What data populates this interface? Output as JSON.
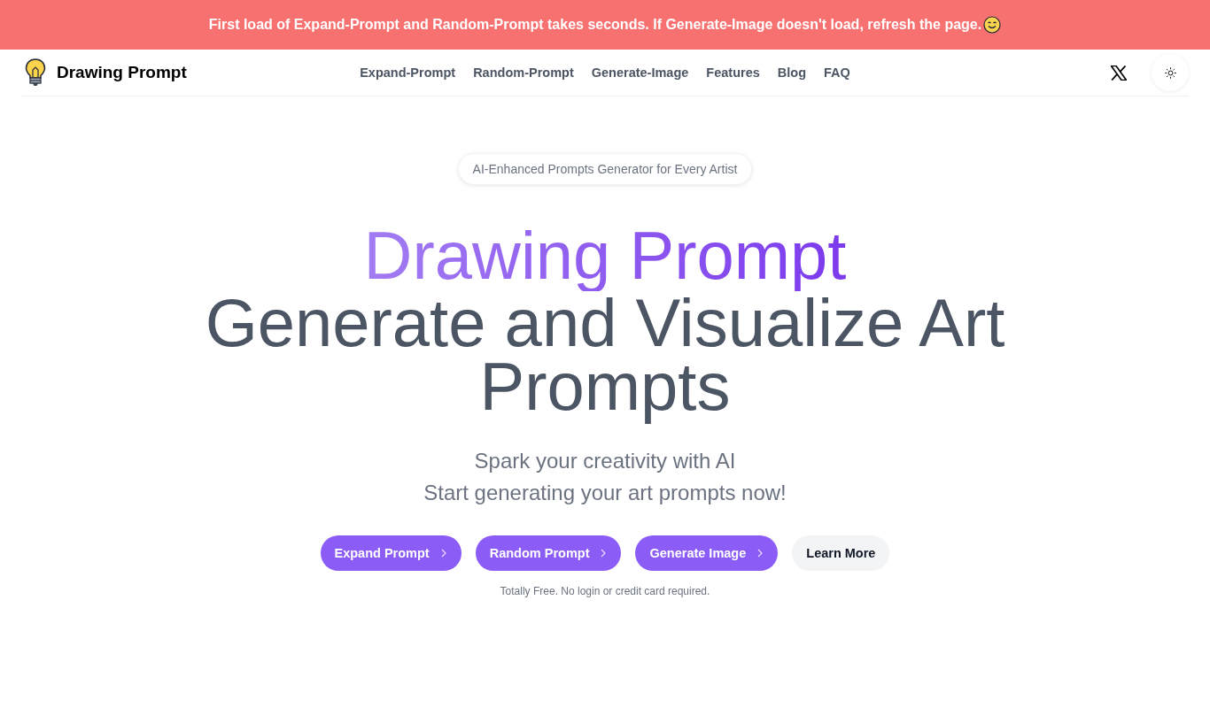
{
  "banner": {
    "text": "First load of Expand-Prompt and Random-Prompt takes seconds. If Generate-Image doesn't load, refresh the page."
  },
  "header": {
    "brand": "Drawing Prompt",
    "nav": [
      "Expand-Prompt",
      "Random-Prompt",
      "Generate-Image",
      "Features",
      "Blog",
      "FAQ"
    ]
  },
  "hero": {
    "badge": "AI-Enhanced Prompts Generator for Every Artist",
    "title": "Drawing Prompt",
    "headline": "Generate and Visualize Art Prompts",
    "tagline": [
      "Spark your creativity with AI",
      "Start generating your art prompts now!"
    ],
    "buttons": [
      {
        "label": "Expand Prompt",
        "kind": "primary"
      },
      {
        "label": "Random Prompt",
        "kind": "primary"
      },
      {
        "label": "Generate Image",
        "kind": "primary"
      },
      {
        "label": "Learn More",
        "kind": "secondary"
      }
    ],
    "note": "Totally Free. No login or credit card required."
  }
}
